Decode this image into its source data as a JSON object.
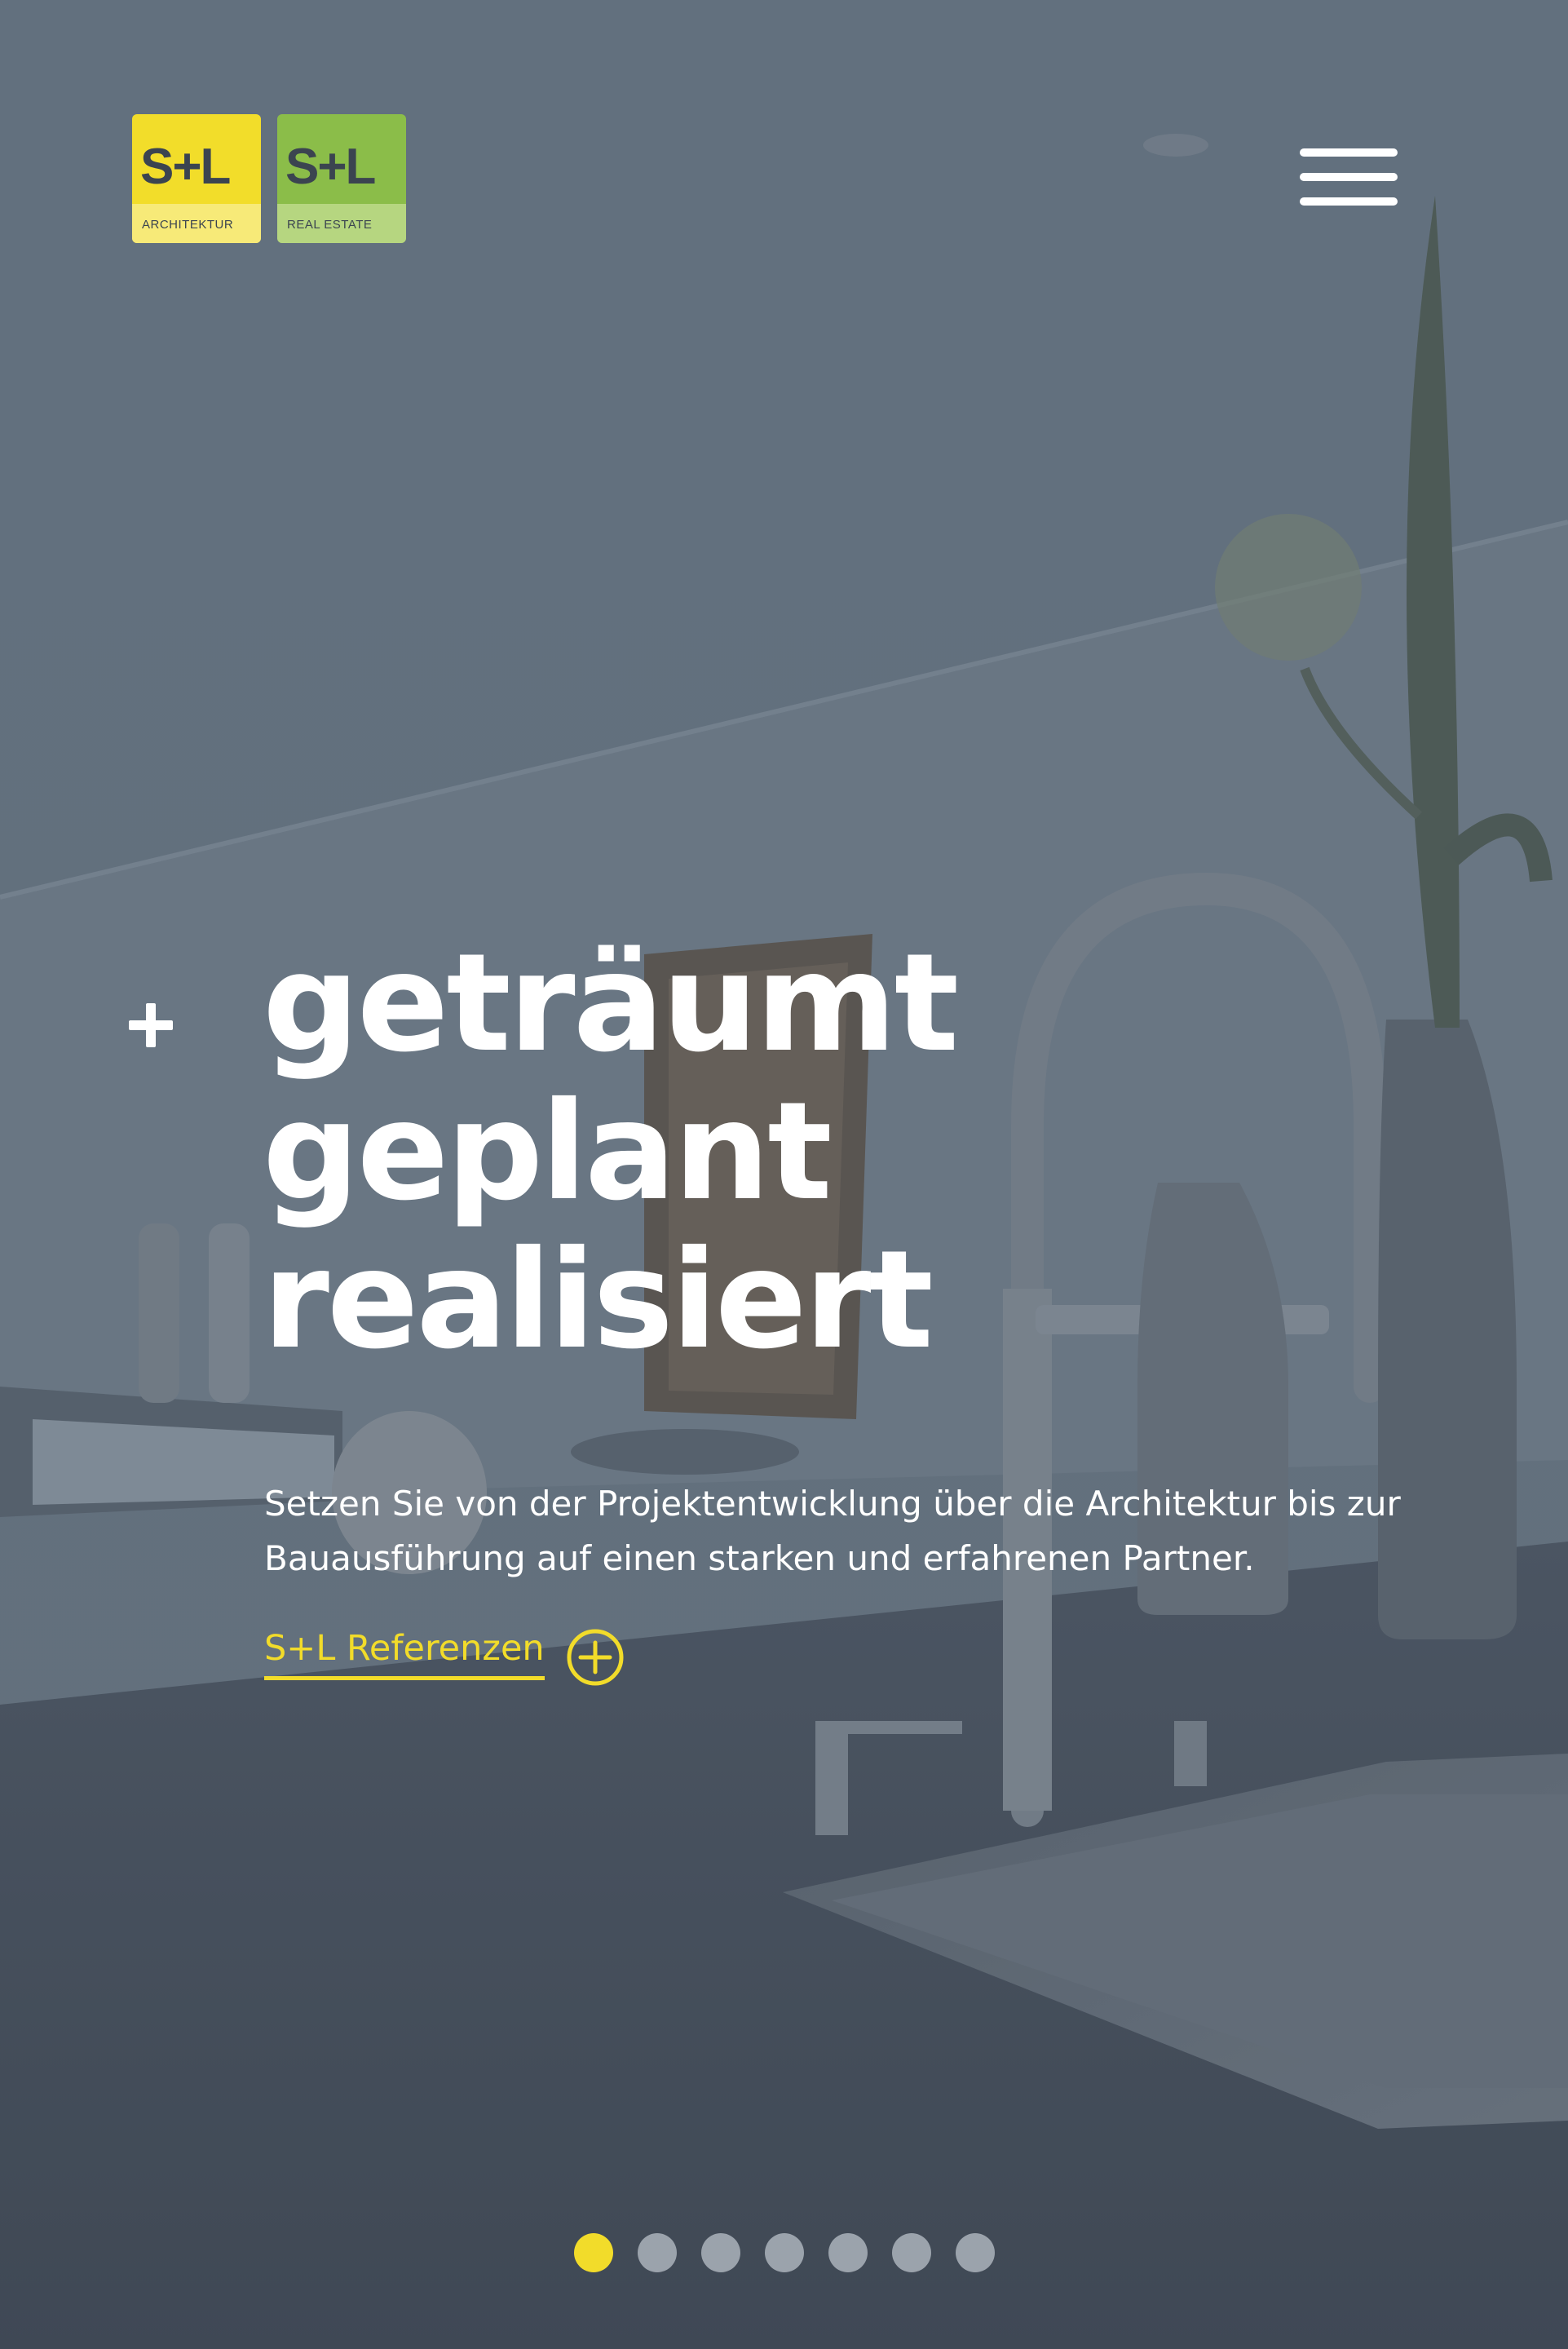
{
  "header": {
    "logos": [
      {
        "main": "S+L",
        "sub": "ARCHITEKTUR",
        "color": "#f2dd2a"
      },
      {
        "main": "S+L",
        "sub": "REAL ESTATE",
        "color": "#8bbd49"
      }
    ],
    "menu_icon": "hamburger-icon"
  },
  "hero": {
    "headline": [
      "geträumt",
      "geplant",
      "realisiert"
    ],
    "intro": "Setzen Sie von der Projektentwicklung über die Architektur bis zur Bauausführung auf einen starken und erfahrenen Partner.",
    "cta_label": "S+L Referenzen",
    "cta_icon": "plus-circle-icon",
    "accent_color": "#f2dc2a"
  },
  "slider": {
    "total": 7,
    "active_index": 0
  }
}
